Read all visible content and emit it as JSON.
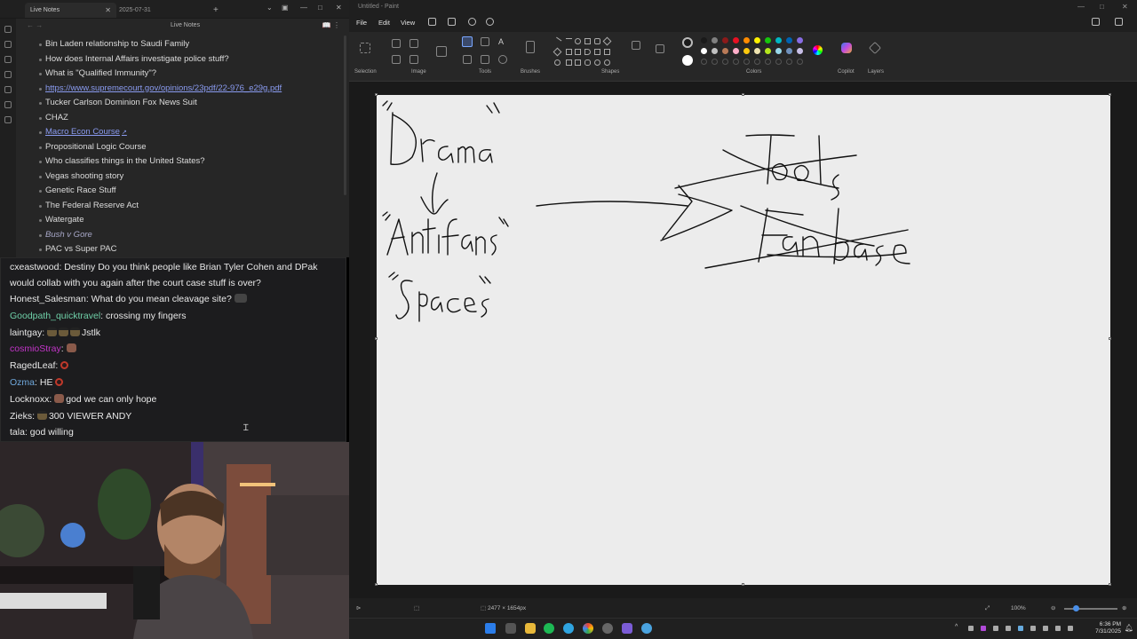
{
  "notes": {
    "tab_title": "Live Notes",
    "tab_date": "2025-07-31",
    "header_title": "Live Notes",
    "items": [
      {
        "text": "Bin Laden relationship to Saudi Family",
        "style": "plain"
      },
      {
        "text": "How does Internal Affairs investigate police stuff?",
        "style": "plain"
      },
      {
        "text": "What is \"Qualified Immunity\"?",
        "style": "plain"
      },
      {
        "text": "https://www.supremecourt.gov/opinions/23pdf/22-976_e29g.pdf",
        "style": "link"
      },
      {
        "text": "Tucker Carlson Dominion Fox News Suit",
        "style": "plain"
      },
      {
        "text": "CHAZ",
        "style": "plain"
      },
      {
        "text": "Macro Econ Course",
        "style": "ilink"
      },
      {
        "text": "Propositional Logic Course",
        "style": "plain"
      },
      {
        "text": "Who classifies things in the United States?",
        "style": "plain"
      },
      {
        "text": "Vegas shooting story",
        "style": "plain"
      },
      {
        "text": "Genetic Race Stuff",
        "style": "plain"
      },
      {
        "text": "The Federal Reserve Act",
        "style": "plain"
      },
      {
        "text": "Watergate",
        "style": "plain"
      },
      {
        "text": "Bush v Gore",
        "style": "italic"
      },
      {
        "text": "PAC vs Super PAC",
        "style": "plain"
      }
    ]
  },
  "chat": {
    "messages": [
      {
        "user": "cxeastwood",
        "user_color": "#e8e8e8",
        "text": "Destiny Do you think people like Brian Tyler Cohen and DPak would collab with you again after the court case stuff is over?",
        "emotes": [],
        "wrap": true
      },
      {
        "user": "Honest_Salesman",
        "user_color": "#e8e8e8",
        "text": "What do you mean cleavage site?",
        "emotes": [
          "skate"
        ]
      },
      {
        "user": "Goodpath_quicktravel",
        "user_color": "#6fd0a8",
        "text": "crossing my fingers",
        "emotes": []
      },
      {
        "user": "laintgay",
        "user_color": "#e8e8e8",
        "text": "Jstlk",
        "emotes_before": [
          "hat",
          "hat",
          "hat"
        ]
      },
      {
        "user": "cosmioStray",
        "user_color": "#c235c8",
        "text": "",
        "emotes_before": [
          "brown"
        ]
      },
      {
        "user": "RagedLeaf",
        "user_color": "#e8e8e8",
        "text": "",
        "emotes_before": [
          "ring"
        ]
      },
      {
        "user": "Ozma",
        "user_color": "#6fa8dc",
        "text": "HE",
        "emotes": [
          "ring"
        ]
      },
      {
        "user": "Locknoxx",
        "user_color": "#e8e8e8",
        "text": "god we can only hope",
        "emotes_before": [
          "brown"
        ]
      },
      {
        "user": "Zieks",
        "user_color": "#e8e8e8",
        "text": "300 VIEWER ANDY",
        "emotes_before": [
          "hat"
        ]
      },
      {
        "user": "tala",
        "user_color": "#e8e8e8",
        "text": "god willing",
        "emotes": []
      }
    ]
  },
  "paint": {
    "window_title": "Untitled - Paint",
    "menu": [
      "File",
      "Edit",
      "View"
    ],
    "groups": {
      "selection": "Selection",
      "image": "Image",
      "tools": "Tools",
      "brushes": "Brushes",
      "shapes": "Shapes",
      "colors": "Colors",
      "copilot": "Copilot",
      "layers": "Layers"
    },
    "palette": [
      "#1a1a1a",
      "#808080",
      "#8b1a1a",
      "#e81123",
      "#ff8c00",
      "#fff100",
      "#16c60c",
      "#00b7c3",
      "#0063b1",
      "#886ce4",
      "#ffffff",
      "#c0c0c0",
      "#b97a57",
      "#ffaec9",
      "#ffc90e",
      "#efe4b0",
      "#b5e61d",
      "#99d9ea",
      "#7092be",
      "#c8bfe7"
    ],
    "canvas_text": [
      "\"Drama\"",
      "\"Antifans\"",
      "\"Spaces\"",
      "Tools",
      "Fanbase"
    ],
    "status_dims": "2477 × 1654px",
    "zoom": "100%"
  },
  "taskbar": {
    "time": "6:36 PM",
    "date": "7/31/2025"
  }
}
